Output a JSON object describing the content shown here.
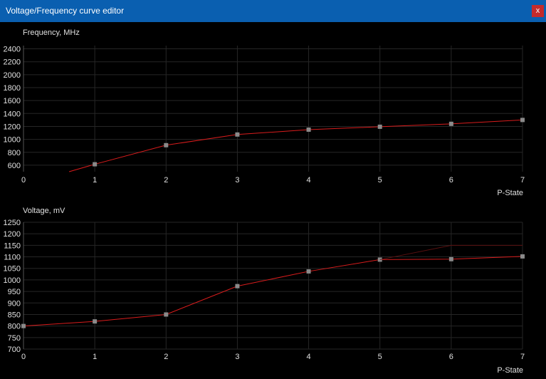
{
  "window": {
    "title": "Voltage/Frequency curve editor",
    "close_glyph": "x",
    "close_icon": "close-icon"
  },
  "colors": {
    "titlebar": "#0a5fb0",
    "close": "#c42b2b",
    "background": "#000000",
    "grid": "#262626",
    "curve": "#d81c1c",
    "point": "#8a8a8a",
    "text": "#e0e0e0"
  },
  "chart_data": [
    {
      "type": "line",
      "title": "Frequency, MHz",
      "xlabel": "P-State",
      "ylabel": "Frequency, MHz",
      "xlim": [
        0,
        7
      ],
      "ylim": [
        500,
        2450
      ],
      "x_ticks": [
        0,
        1,
        2,
        3,
        4,
        5,
        6,
        7
      ],
      "y_ticks": [
        600,
        800,
        1000,
        1200,
        1400,
        1600,
        1800,
        2000,
        2200,
        2400
      ],
      "grid": true,
      "series": [
        {
          "points": [
            [
              0.64,
              500
            ],
            [
              1,
              615
            ],
            [
              2,
              910
            ],
            [
              3,
              1075
            ],
            [
              4,
              1150
            ],
            [
              5,
              1195
            ],
            [
              6,
              1240
            ],
            [
              7,
              1300
            ]
          ],
          "markers": [
            [
              1,
              615
            ],
            [
              2,
              910
            ],
            [
              3,
              1075
            ],
            [
              4,
              1150
            ],
            [
              5,
              1195
            ],
            [
              6,
              1240
            ],
            [
              7,
              1300
            ]
          ]
        }
      ]
    },
    {
      "type": "line",
      "title": "Voltage, mV",
      "xlabel": "P-State",
      "ylabel": "Voltage, mV",
      "xlim": [
        0,
        7
      ],
      "ylim": [
        700,
        1250
      ],
      "x_ticks": [
        0,
        1,
        2,
        3,
        4,
        5,
        6,
        7
      ],
      "y_ticks": [
        700,
        750,
        800,
        850,
        900,
        950,
        1000,
        1050,
        1100,
        1150,
        1200,
        1250
      ],
      "grid": true,
      "series": [
        {
          "points": [
            [
              0,
              800
            ],
            [
              1,
              820
            ],
            [
              2,
              850
            ],
            [
              3,
              973
            ],
            [
              4,
              1037
            ],
            [
              5,
              1088
            ],
            [
              6,
              1090
            ],
            [
              7,
              1102
            ]
          ],
          "markers": [
            [
              0,
              800
            ],
            [
              1,
              820
            ],
            [
              2,
              850
            ],
            [
              3,
              973
            ],
            [
              4,
              1037
            ],
            [
              5,
              1088
            ],
            [
              6,
              1090
            ],
            [
              7,
              1102
            ]
          ]
        },
        {
          "style": "faint",
          "points": [
            [
              5,
              1088
            ],
            [
              6,
              1150
            ],
            [
              7,
              1150
            ]
          ],
          "markers": []
        }
      ]
    }
  ]
}
